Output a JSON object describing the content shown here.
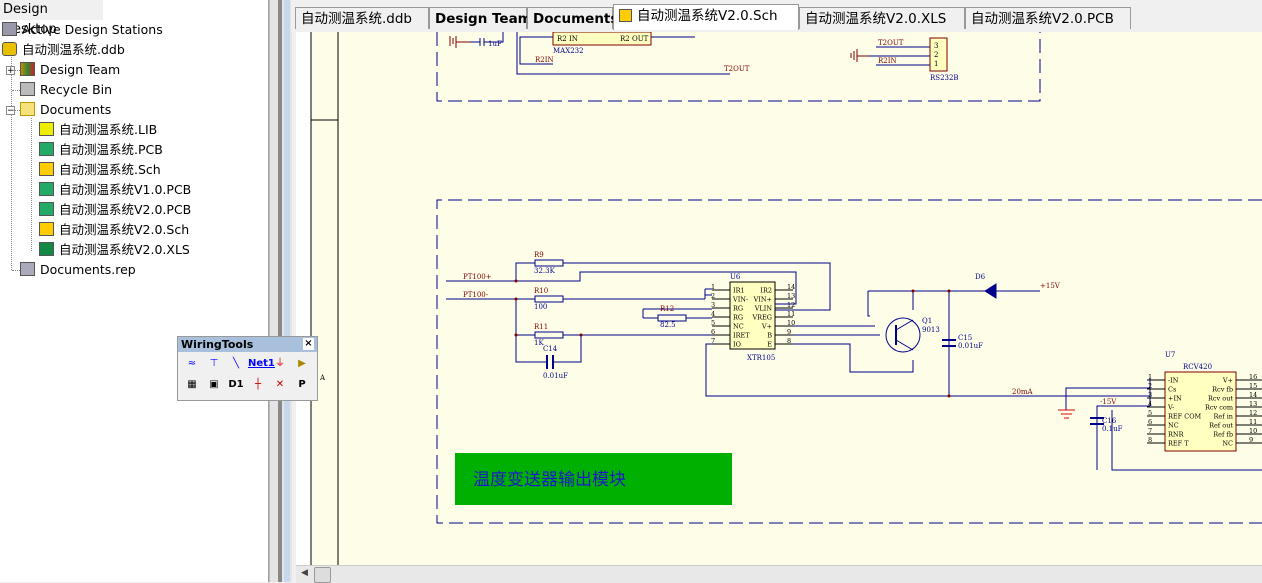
{
  "panel": {
    "title": "Design Desktop",
    "items": [
      {
        "label": "Active Design Stations",
        "icon": "workstation-icon"
      },
      {
        "label": "自动测温系统.ddb",
        "icon": "database-icon"
      },
      {
        "label": "Design Team",
        "icon": "team-icon"
      },
      {
        "label": "Recycle Bin",
        "icon": "recycle-bin-icon"
      },
      {
        "label": "Documents",
        "icon": "folder-icon"
      },
      {
        "label": "自动测温系统.LIB",
        "icon": "library-icon"
      },
      {
        "label": "自动测温系统.PCB",
        "icon": "pcb-icon"
      },
      {
        "label": "自动测温系统.Sch",
        "icon": "schematic-icon"
      },
      {
        "label": "自动测温系统V1.0.PCB",
        "icon": "pcb-icon"
      },
      {
        "label": "自动测温系统V2.0.PCB",
        "icon": "pcb-icon"
      },
      {
        "label": "自动测温系统V2.0.Sch",
        "icon": "schematic-icon"
      },
      {
        "label": "自动测温系统V2.0.XLS",
        "icon": "spreadsheet-icon"
      },
      {
        "label": "Documents.rep",
        "icon": "report-icon"
      }
    ]
  },
  "tabs": [
    "自动测温系统.ddb",
    "Design Team",
    "Documents",
    "自动测温系统V2.0.Sch",
    "自动测温系统V2.0.XLS",
    "自动测温系统V2.0.PCB"
  ],
  "active_tab": 3,
  "wiring_tools": {
    "title": "WiringTools",
    "close": "×",
    "tools": [
      "wire",
      "bus",
      "bus-entry",
      "Net1",
      "ground",
      "power-port",
      "component",
      "sheet-symbol",
      "D1",
      "junction",
      "no-erc",
      "P"
    ]
  },
  "schematic": {
    "zone_label": "A",
    "top": {
      "max232": "MAX232",
      "r2in": "R2 IN",
      "r2out": "R2 OUT",
      "net_r2in": "R2IN",
      "net_t2out": "T2OUT",
      "cap": "1uF",
      "conn_t2out": "T2OUT",
      "conn_r2in": "R2IN",
      "conn": "RS232B",
      "pins": [
        "3",
        "2",
        "1"
      ]
    },
    "pt100p": "PT100+",
    "pt100m": "PT100-",
    "r9": "R9",
    "r9v": "32.3K",
    "r10": "R10",
    "r10v": "100",
    "r11": "R11",
    "r11v": "1K",
    "r12": "R12",
    "r12v": "82.5",
    "c14": "C14",
    "c14v": "0.01uF",
    "u6": "U6",
    "u6name": "XTR105",
    "u6left": [
      [
        "1",
        "IR1"
      ],
      [
        "2",
        "VIN-"
      ],
      [
        "3",
        "RG"
      ],
      [
        "4",
        "RG"
      ],
      [
        "5",
        "NC"
      ],
      [
        "6",
        "IRET"
      ],
      [
        "7",
        "IO"
      ]
    ],
    "u6right": [
      [
        "14",
        "IR2"
      ],
      [
        "13",
        "VIN+"
      ],
      [
        "12",
        "VLIN"
      ],
      [
        "11",
        "VREG"
      ],
      [
        "10",
        "V+"
      ],
      [
        "9",
        "B"
      ],
      [
        "8",
        "E"
      ]
    ],
    "d6": "D6",
    "p15": "+15V",
    "q1": "Q1",
    "q1v": "9013",
    "c15": "C15",
    "c15v": "0.01uF",
    "i20": "20mA",
    "m15": "-15V",
    "c16": "C16",
    "c16v": "0.1uF",
    "u7": "U7",
    "u7name": "RCV420",
    "u7left": [
      [
        "1",
        "-IN"
      ],
      [
        "2",
        "Cs"
      ],
      [
        "3",
        "+IN"
      ],
      [
        "4",
        "V-"
      ],
      [
        "5",
        "REF COM"
      ],
      [
        "6",
        "NC"
      ],
      [
        "7",
        "RNR"
      ],
      [
        "8",
        "REF T"
      ]
    ],
    "u7right": [
      [
        "16",
        "V+"
      ],
      [
        "15",
        "Rcv fb"
      ],
      [
        "14",
        "Rcv out"
      ],
      [
        "13",
        "Rcv com"
      ],
      [
        "12",
        "Ref in"
      ],
      [
        "11",
        "Ref out"
      ],
      [
        "10",
        "Ref fb"
      ],
      [
        "9",
        "NC"
      ]
    ],
    "module_label": "温度变送器输出模块",
    "module_color": "#00b000"
  }
}
